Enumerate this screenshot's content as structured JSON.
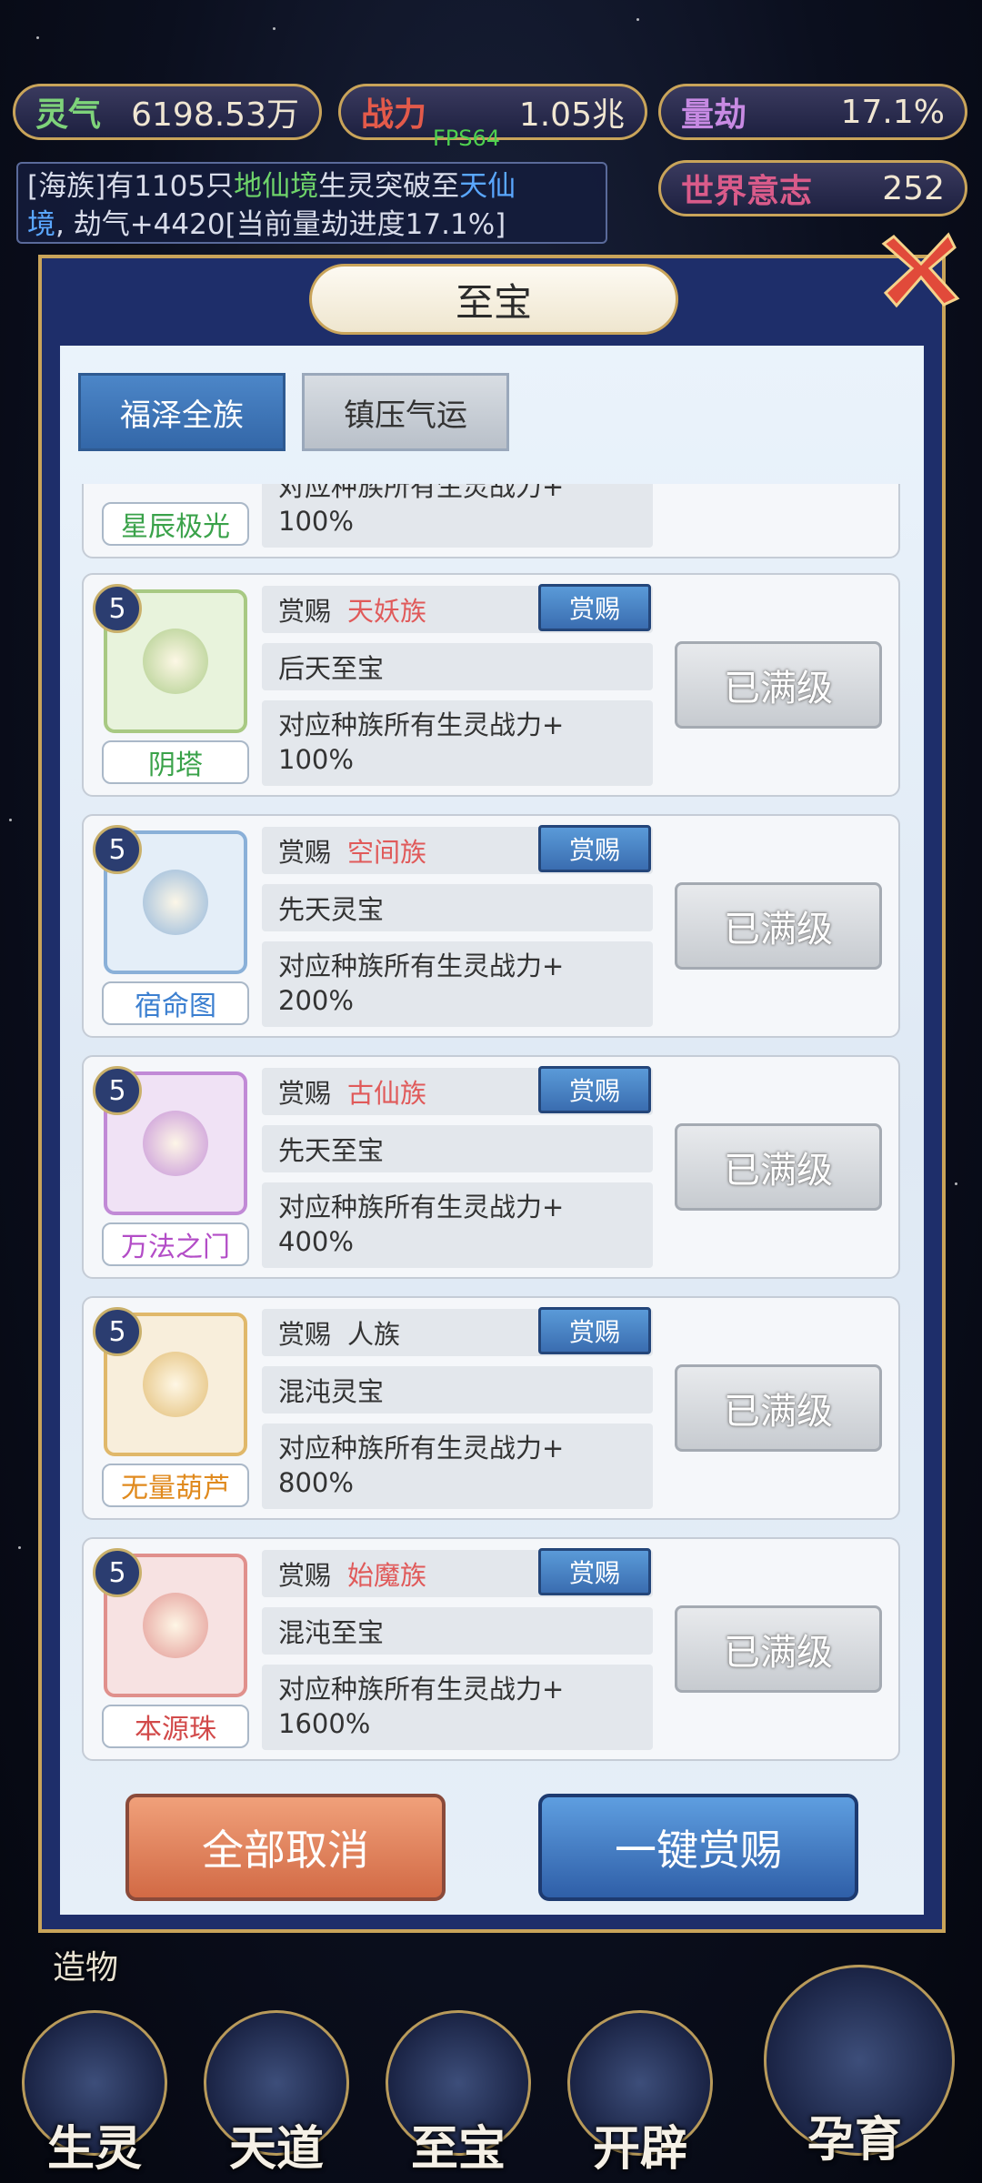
{
  "hud": {
    "lingqi": {
      "label": "灵气",
      "value": "6198.53万"
    },
    "zhanli": {
      "label": "战力",
      "value": "1.05兆"
    },
    "liangjie": {
      "label": "量劫",
      "value": "17.1%"
    },
    "shijie": {
      "label": "世界意志",
      "value": "252"
    },
    "fps": "FPS64"
  },
  "log": {
    "p1": "[海族]有1105只",
    "hl1": "地仙境",
    "p2": "生灵突破至",
    "hl2": "天仙",
    "p3": "境",
    "p4": ", 劫气+4420[当前量劫进度17.1%]"
  },
  "panel": {
    "title": "至宝",
    "tabs": [
      "福泽全族",
      "镇压气运"
    ]
  },
  "partial_item": {
    "desc_line1": "对应种族所有生灵战力+",
    "desc_line2": "100%",
    "name": "星辰极光"
  },
  "items": [
    {
      "level": "5",
      "reward_label": "赏赐",
      "race": "天妖族",
      "reward_btn": "赏赐",
      "grade": "后天至宝",
      "desc_line1": "对应种族所有生灵战力+",
      "desc_line2": "100%",
      "name": "阴塔",
      "status": "已满级",
      "name_color": "#3aa24a",
      "icon_border": "#a8c983"
    },
    {
      "level": "5",
      "reward_label": "赏赐",
      "race": "空间族",
      "reward_btn": "赏赐",
      "grade": "先天灵宝",
      "desc_line1": "对应种族所有生灵战力+",
      "desc_line2": "200%",
      "name": "宿命图",
      "status": "已满级",
      "name_color": "#3b7fd0",
      "icon_border": "#8ab0d8"
    },
    {
      "level": "5",
      "reward_label": "赏赐",
      "race": "古仙族",
      "reward_btn": "赏赐",
      "grade": "先天至宝",
      "desc_line1": "对应种族所有生灵战力+",
      "desc_line2": "400%",
      "name": "万法之门",
      "status": "已满级",
      "name_color": "#b34dc7",
      "icon_border": "#c18ad6"
    },
    {
      "level": "5",
      "reward_label": "赏赐",
      "race": "人族",
      "reward_btn": "赏赐",
      "grade": "混沌灵宝",
      "desc_line1": "对应种族所有生灵战力+",
      "desc_line2": "800%",
      "name": "无量葫芦",
      "status": "已满级",
      "name_color": "#e08a1e",
      "icon_border": "#e0b86a"
    },
    {
      "level": "5",
      "reward_label": "赏赐",
      "race": "始魔族",
      "reward_btn": "赏赐",
      "grade": "混沌至宝",
      "desc_line1": "对应种族所有生灵战力+",
      "desc_line2": "1600%",
      "name": "本源珠",
      "status": "已满级",
      "name_color": "#d24a4a",
      "icon_border": "#e0908c"
    }
  ],
  "buttons": {
    "cancel_all": "全部取消",
    "one_key_reward": "一键赏赐"
  },
  "side_label": "造物",
  "nav": [
    "生灵",
    "天道",
    "至宝",
    "开辟",
    "孕育"
  ]
}
